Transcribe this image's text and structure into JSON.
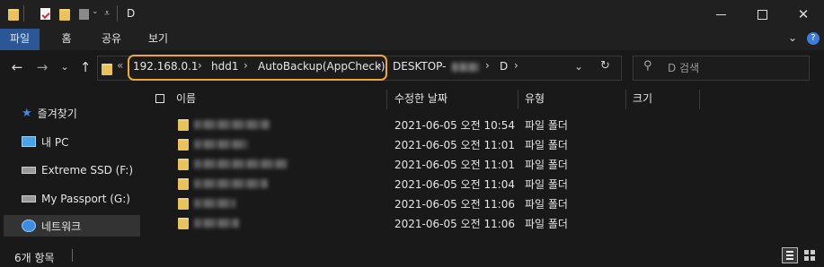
{
  "window": {
    "title": "D"
  },
  "ribbon": {
    "tabs": [
      "파일",
      "홈",
      "공유",
      "보기"
    ]
  },
  "address": {
    "crumbs": [
      "192.168.0.1",
      "hdd1",
      "AutoBackup(AppCheck)",
      "DESKTOP-",
      "D"
    ],
    "prefix": "«"
  },
  "search": {
    "placeholder": "D 검색"
  },
  "columns": {
    "name": "이름",
    "modified": "수정한 날짜",
    "type": "유형",
    "size": "크기"
  },
  "sidebar": {
    "items": [
      {
        "label": "즐겨찾기",
        "icon": "star-icon"
      },
      {
        "label": "내 PC",
        "icon": "pc-icon"
      },
      {
        "label": "Extreme SSD (F:)",
        "icon": "drive-icon"
      },
      {
        "label": "My Passport (G:)",
        "icon": "drive-icon"
      },
      {
        "label": "네트워크",
        "icon": "network-icon"
      }
    ]
  },
  "files": [
    {
      "modified": "2021-06-05 오전 10:54",
      "type": "파일 폴더"
    },
    {
      "modified": "2021-06-05 오전 11:01",
      "type": "파일 폴더"
    },
    {
      "modified": "2021-06-05 오전 11:01",
      "type": "파일 폴더"
    },
    {
      "modified": "2021-06-05 오전 11:04",
      "type": "파일 폴더"
    },
    {
      "modified": "2021-06-05 오전 11:06",
      "type": "파일 폴더"
    },
    {
      "modified": "2021-06-05 오전 11:06",
      "type": "파일 폴더"
    }
  ],
  "status": {
    "count": "6개 항목"
  },
  "colors": {
    "accent": "#2b5797",
    "highlight": "#f0a830",
    "folder": "#e8c25a"
  }
}
